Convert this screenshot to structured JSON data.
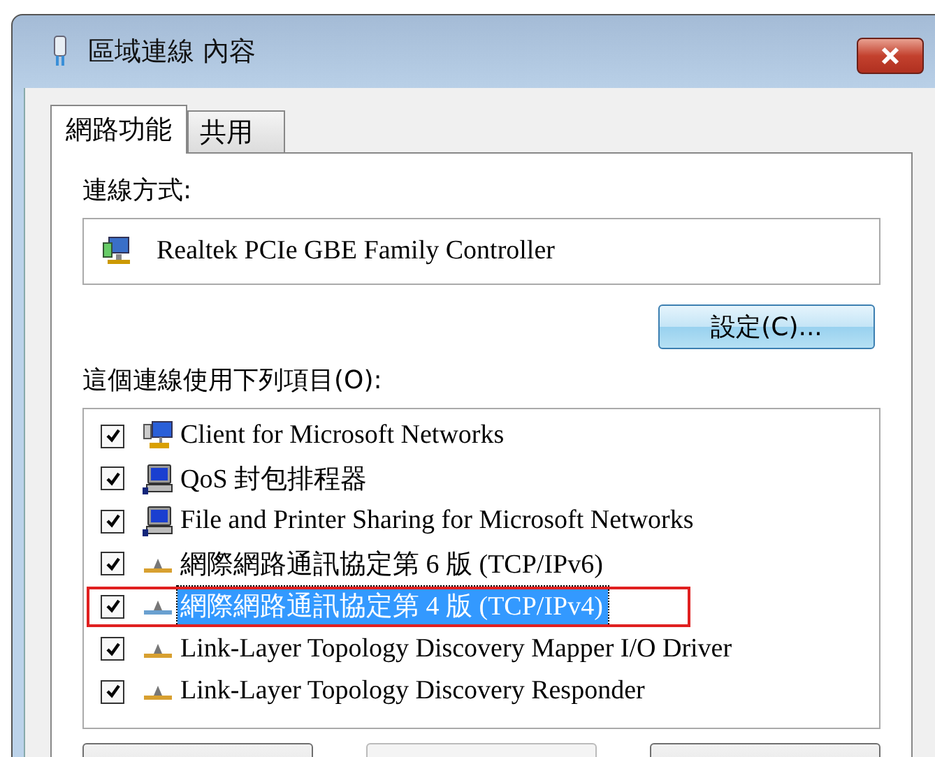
{
  "window": {
    "title": "區域連線 內容"
  },
  "tabs": [
    {
      "label": "網路功能",
      "selected": true
    },
    {
      "label": "共用",
      "selected": false
    }
  ],
  "connect_using": {
    "label": "連線方式:",
    "adapter": "Realtek PCIe GBE Family Controller"
  },
  "configure_button": "設定(C)...",
  "items_label": "這個連線使用下列項目(O):",
  "items": [
    {
      "kind": "client",
      "label": "Client for Microsoft Networks",
      "checked": true,
      "selected": false,
      "highlighted": false
    },
    {
      "kind": "service",
      "label": "QoS 封包排程器",
      "checked": true,
      "selected": false,
      "highlighted": false
    },
    {
      "kind": "service",
      "label": "File and Printer Sharing for Microsoft Networks",
      "checked": true,
      "selected": false,
      "highlighted": false
    },
    {
      "kind": "protocol",
      "label": "網際網路通訊協定第 6 版 (TCP/IPv6)",
      "checked": true,
      "selected": false,
      "highlighted": false
    },
    {
      "kind": "protocol",
      "label": "網際網路通訊協定第 4 版 (TCP/IPv4)",
      "checked": true,
      "selected": true,
      "highlighted": true
    },
    {
      "kind": "protocol",
      "label": "Link-Layer Topology Discovery Mapper I/O Driver",
      "checked": true,
      "selected": false,
      "highlighted": false
    },
    {
      "kind": "protocol",
      "label": "Link-Layer Topology Discovery Responder",
      "checked": true,
      "selected": false,
      "highlighted": false
    }
  ],
  "bottom_buttons": [
    {
      "disabled": false
    },
    {
      "disabled": true
    },
    {
      "disabled": false
    }
  ]
}
